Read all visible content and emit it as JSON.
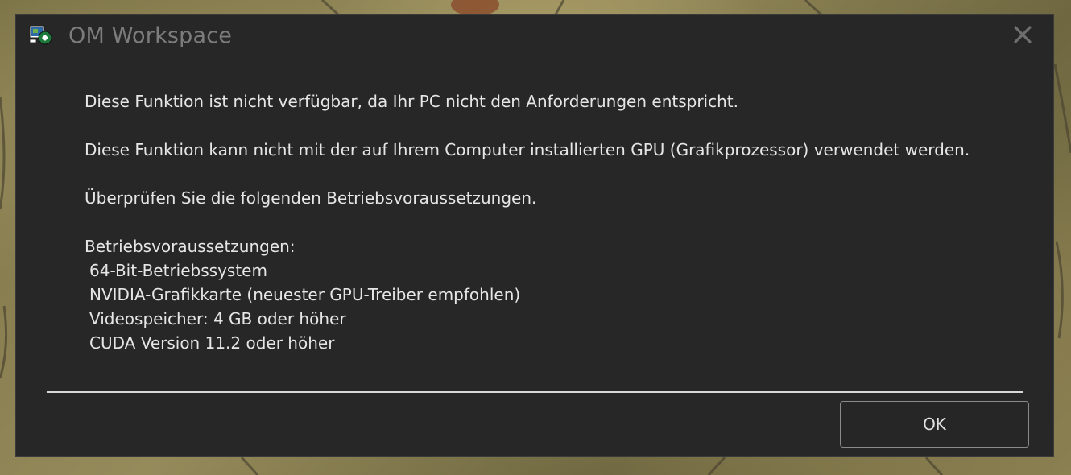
{
  "window": {
    "title": "OM Workspace",
    "app_icon": "om-workspace-app-icon",
    "close_icon": "close-icon"
  },
  "message": {
    "line1": "Diese Funktion ist nicht verfügbar, da Ihr PC nicht den Anforderungen entspricht.",
    "line2": "Diese Funktion kann nicht mit der auf Ihrem Computer installierten GPU (Grafikprozessor) verwendet werden.",
    "line3": "Überprüfen Sie die folgenden Betriebsvoraussetzungen.",
    "requirements_heading": "Betriebsvoraussetzungen:",
    "requirements": [
      "64-Bit-Betriebssystem",
      "NVIDIA-Grafikkarte (neuester GPU-Treiber empfohlen)",
      "Videospeicher: 4 GB oder höher",
      "CUDA Version 11.2 oder höher"
    ]
  },
  "buttons": {
    "ok_label": "OK"
  },
  "colors": {
    "dialog_background": "#272727",
    "text": "#e6e6e6",
    "title_text": "#7c7c7c"
  }
}
